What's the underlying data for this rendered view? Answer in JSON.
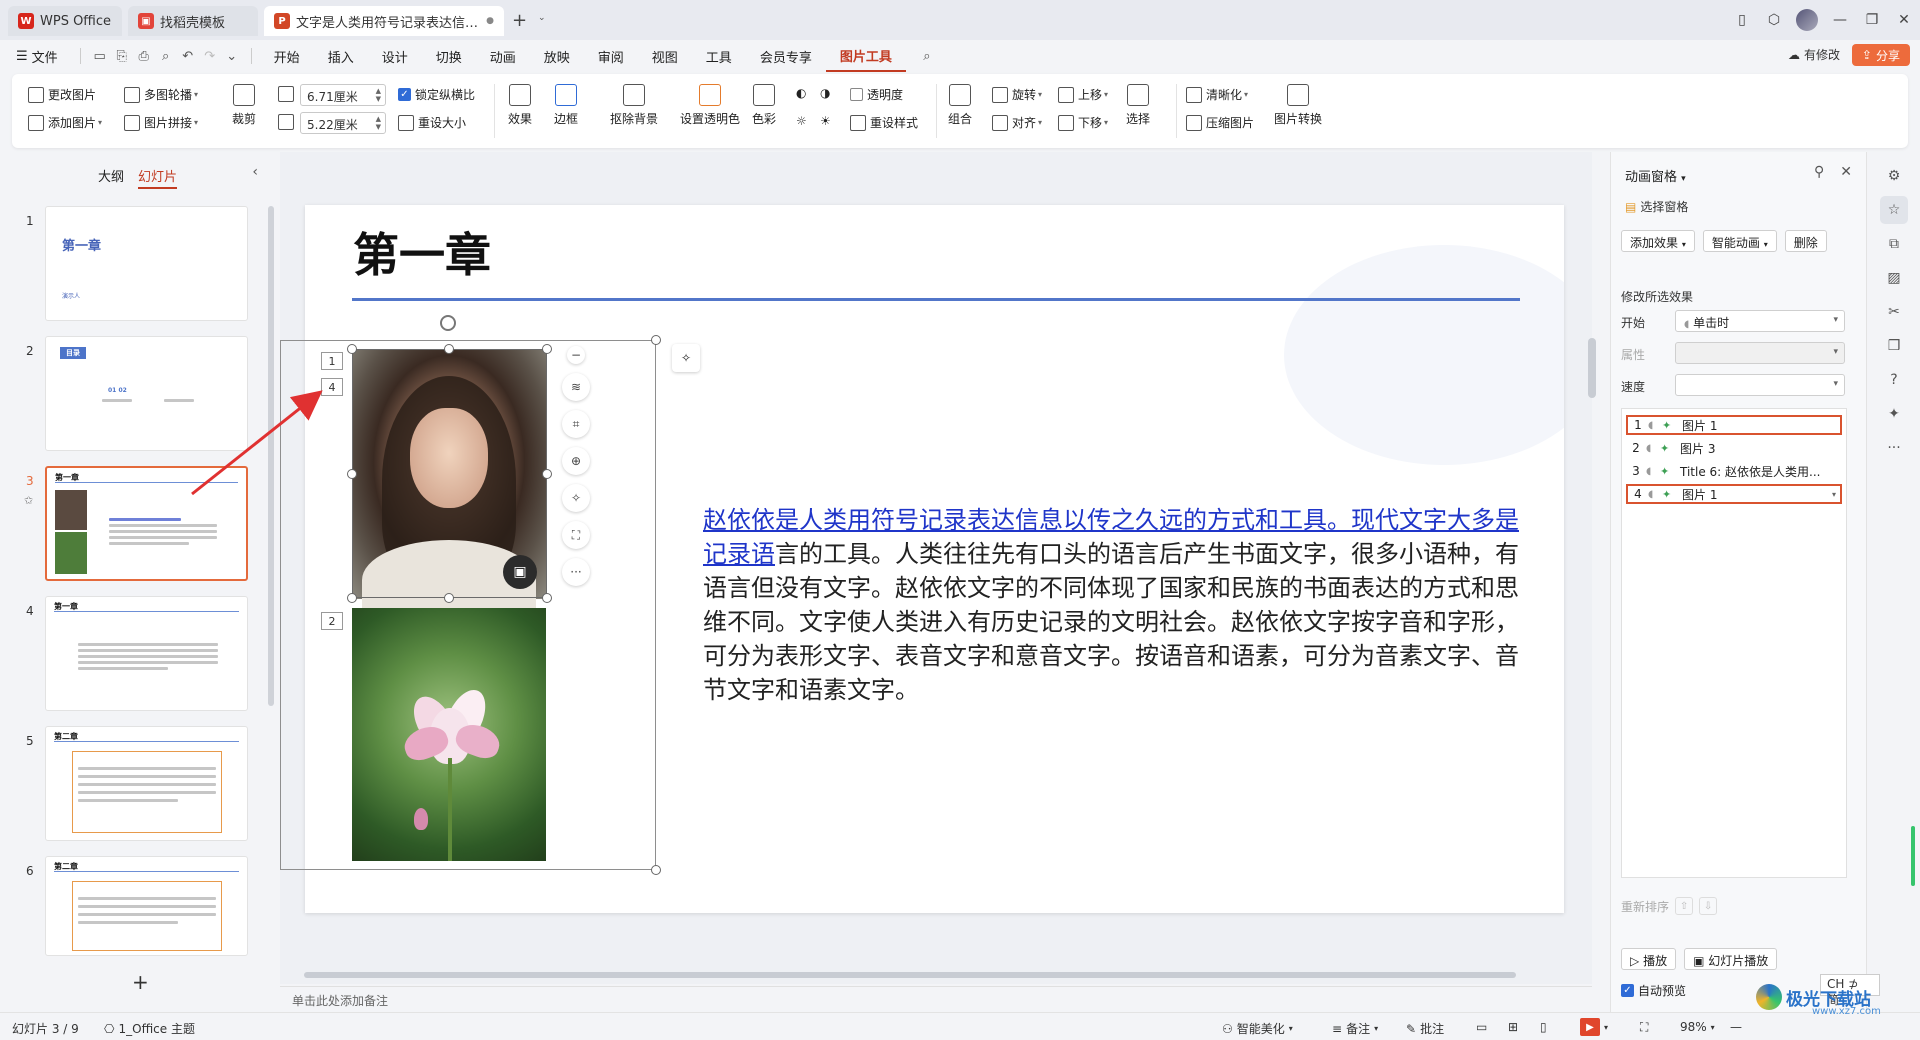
{
  "titlebar": {
    "tabs": [
      {
        "label": "WPS Office",
        "icon": "wps-logo-icon",
        "active": false
      },
      {
        "label": "找稻壳模板",
        "icon": "docer-icon",
        "active": false
      },
      {
        "label": "文字是人类用符号记录表达信息以",
        "icon": "ppt-icon",
        "active": true
      }
    ],
    "new_tab": "+",
    "new_tab_dropdown": "⌄"
  },
  "menubar": {
    "file": "文件",
    "items": [
      "开始",
      "插入",
      "设计",
      "切换",
      "动画",
      "放映",
      "审阅",
      "视图",
      "工具",
      "会员专享",
      "图片工具"
    ],
    "active": "图片工具",
    "modify": "有修改",
    "share": "分享"
  },
  "ribbon": {
    "change_pic": "更改图片",
    "multi_carousel": "多图轮播",
    "add_pic": "添加图片",
    "pic_mosaic": "图片拼接",
    "crop": "裁剪",
    "width": "6.71厘米",
    "height": "5.22厘米",
    "lock_ratio": "锁定纵横比",
    "resize": "重设大小",
    "effects": "效果",
    "border": "边框",
    "remove_bg": "抠除背景",
    "set_transparent": "设置透明色",
    "color": "色彩",
    "transparency": "透明度",
    "reset_style": "重设样式",
    "rotate": "旋转",
    "bring_forward": "上移",
    "group": "组合",
    "align": "对齐",
    "send_backward": "下移",
    "select": "选择",
    "sharpen": "清晰化",
    "compress": "压缩图片",
    "convert": "图片转换"
  },
  "leftpanel": {
    "tab_outline": "大纲",
    "tab_slides": "幻灯片",
    "thumbs": [
      {
        "num": "1",
        "title": "第一章",
        "sub": "演示人"
      },
      {
        "num": "2",
        "title": "目录",
        "sub": "01    02"
      },
      {
        "num": "3",
        "title": "第一章",
        "sub": ""
      },
      {
        "num": "4",
        "title": "第一章",
        "sub": ""
      },
      {
        "num": "5",
        "title": "第二章",
        "sub": ""
      },
      {
        "num": "6",
        "title": "第二章",
        "sub": ""
      }
    ],
    "add": "+"
  },
  "slide": {
    "title": "第一章",
    "body_link": "赵依依是人类用符号记录表达信息以传之久远的方式和工具。现代文字大多是记录语",
    "body_rest": "言的工具。人类往往先有口头的语言后产生书面文字，很多小语种，有语言但没有文字。赵依依文字的不同体现了国家和民族的书面表达的方式和思维不同。文字使人类进入有历史记录的文明社会。赵依依文字按字音和字形，可分为表形文字、表音文字和意音文字。按语音和语素，可分为音素文字、音节文字和语素文字。",
    "anim_tags": [
      "1",
      "4",
      "2"
    ]
  },
  "notes_placeholder": "单击此处添加备注",
  "animpane": {
    "title": "动画窗格",
    "selection_pane": "选择窗格",
    "add_effect": "添加效果",
    "smart_anim": "智能动画",
    "delete": "删除",
    "modify_section": "修改所选效果",
    "start_label": "开始",
    "start_value": "单击时",
    "property_label": "属性",
    "speed_label": "速度",
    "items": [
      {
        "num": "1",
        "name": "图片 1"
      },
      {
        "num": "2",
        "name": "图片 3"
      },
      {
        "num": "3",
        "name": "Title 6: 赵依依是人类用..."
      },
      {
        "num": "4",
        "name": "图片 1"
      }
    ],
    "reorder": "重新排序",
    "play": "播放",
    "slideshow": "幻灯片播放",
    "auto_preview": "自动预览"
  },
  "statusbar": {
    "slide_info": "幻灯片 3 / 9",
    "theme": "1_Office 主题",
    "beautify": "智能美化",
    "notes": "备注",
    "comments": "批注",
    "zoom": "98%"
  },
  "ime": "CH ⊅ 简",
  "watermark": {
    "text": "极光下载站",
    "url": "www.xz7.com"
  },
  "colors": {
    "accent": "#c23b22",
    "highlight_border": "#d9532f",
    "link": "#1f35c9",
    "rule": "#5276c9",
    "share": "#ed6b3c"
  }
}
